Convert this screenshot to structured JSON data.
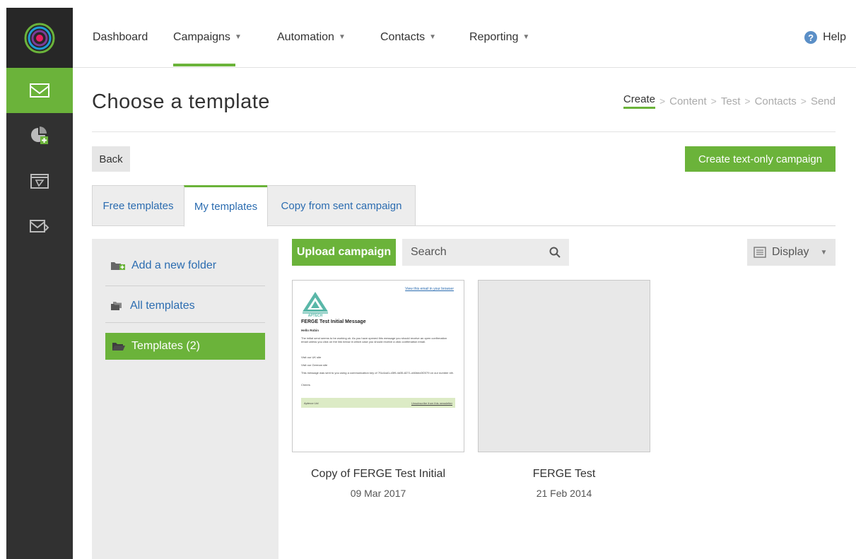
{
  "nav": {
    "items": [
      {
        "label": "Dashboard",
        "has_caret": false
      },
      {
        "label": "Campaigns",
        "has_caret": true
      },
      {
        "label": "Automation",
        "has_caret": true
      },
      {
        "label": "Contacts",
        "has_caret": true
      },
      {
        "label": "Reporting",
        "has_caret": true
      }
    ],
    "active": "Campaigns",
    "caret": "▼",
    "help_label": "Help",
    "help_icon": "?"
  },
  "rail": {
    "items": [
      "email-campaigns-icon",
      "reports-add-icon",
      "automation-icon",
      "email-forward-icon"
    ],
    "active": "email-campaigns-icon"
  },
  "page": {
    "title": "Choose a template",
    "steps": [
      "Create",
      "Content",
      "Test",
      "Contacts",
      "Send"
    ],
    "active_step": "Create",
    "step_separator": ">"
  },
  "actions": {
    "back_label": "Back",
    "create_text_only_label": "Create text-only campaign"
  },
  "tabs": [
    {
      "label": "Free templates",
      "active": false
    },
    {
      "label": "My templates",
      "active": true
    },
    {
      "label": "Copy from sent campaign",
      "active": false
    }
  ],
  "folders": {
    "add_label": "Add a new folder",
    "all_label": "All templates",
    "selected_label": "Templates (2)"
  },
  "toolbar": {
    "upload_label": "Upload campaign",
    "search_placeholder": "Search",
    "display_label": "Display",
    "display_caret": "▼"
  },
  "templates": [
    {
      "name": "Copy of FERGE Test Initial",
      "date": "09 Mar 2017",
      "thumbnail": {
        "view_link": "View this email in your browser",
        "logo_text": "APTECH",
        "heading": "FERGE Test Initial Message",
        "greeting": "Hello Robin",
        "para1": "The initial send seems to be working ok. As you have opened this message you should receive an open confirmation email unless you click on the link below in which case you should receive a click confirmation email.",
        "para2": "Visit our UK site",
        "para3": "Visit our German site",
        "para4": "This message was sent to you using a communication key of 7f1c4ad1-d3f9-4d35-8271-d46bec0f2079 on our number xlit.",
        "para5": "Cheers",
        "footer_left": "Aptecor Ltd",
        "footer_right": "Unsubscribe from this newsletter"
      }
    },
    {
      "name": "FERGE Test",
      "date": "21 Feb 2014"
    }
  ],
  "colors": {
    "accent_green": "#6bb33a",
    "rail_dark": "#313131",
    "link_blue": "#2b6cb0"
  }
}
